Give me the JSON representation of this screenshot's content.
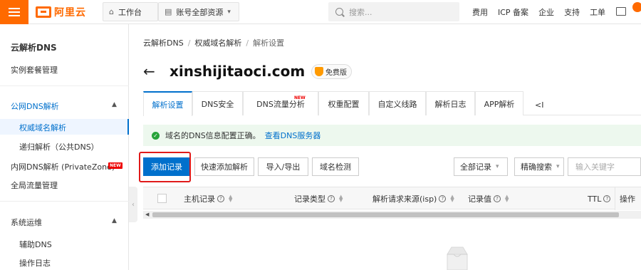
{
  "topbar": {
    "logo_text": "阿里云",
    "workbench": "工作台",
    "resources": "账号全部资源",
    "search_placeholder": "搜索...",
    "links": [
      "费用",
      "ICP 备案",
      "企业",
      "支持",
      "工单"
    ]
  },
  "sidebar": {
    "title": "云解析DNS",
    "instance_mgmt": "实例套餐管理",
    "public_dns_group": "公网DNS解析",
    "authoritative": "权威域名解析",
    "recursive": "递归解析（公共DNS）",
    "private_zone": "内网DNS解析 (PrivateZone)",
    "new_badge": "NEW",
    "gtm": "全局流量管理",
    "ops_group": "系统运维",
    "aux_dns": "辅助DNS",
    "op_log": "操作日志"
  },
  "breadcrumb": [
    "云解析DNS",
    "权威域名解析",
    "解析设置"
  ],
  "domain": {
    "name": "xinshijitaoci.com",
    "edition": "免费版"
  },
  "tabs": [
    {
      "label": "解析设置"
    },
    {
      "label": "DNS安全"
    },
    {
      "label": "DNS流量分析"
    },
    {
      "label": "权重配置"
    },
    {
      "label": "自定义线路"
    },
    {
      "label": "解析日志"
    },
    {
      "label": "APP解析"
    }
  ],
  "tab_new": "NEW",
  "tab_more": "<I",
  "notice": {
    "text": "域名的DNS信息配置正确。",
    "link": "查看DNS服务器"
  },
  "toolbar": {
    "add_record": "添加记录",
    "quick_add": "快速添加解析",
    "import_export": "导入/导出",
    "domain_check": "域名检测",
    "all_records": "全部记录",
    "exact_search": "精确搜索",
    "keyword_placeholder": "输入关键字"
  },
  "table": {
    "columns": [
      "主机记录",
      "记录类型",
      "解析请求来源(isp)",
      "记录值",
      "TTL",
      "操作"
    ]
  },
  "colors": {
    "brand": "#ff6a00",
    "primary": "#0070cc",
    "highlight": "#e01a1a",
    "success": "#27a33a"
  }
}
